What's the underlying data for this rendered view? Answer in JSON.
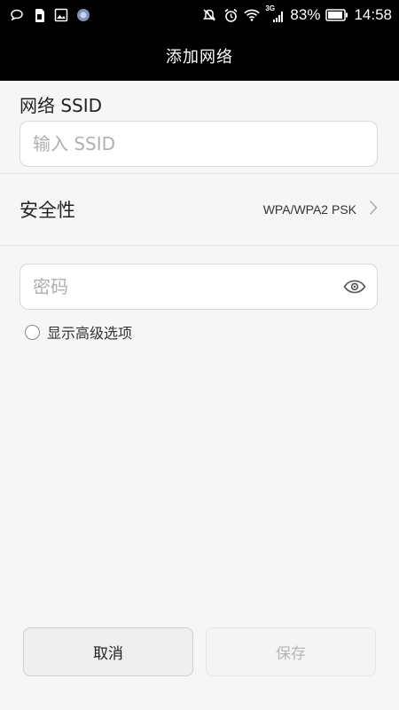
{
  "status_bar": {
    "battery": "83%",
    "time": "14:58",
    "network": "3G",
    "left_icons": [
      "chat-bubble-icon",
      "sim-card-icon",
      "image-icon",
      "app-circle-icon"
    ],
    "right_icons": [
      "vibrate-off-icon",
      "alarm-icon",
      "wifi-icon",
      "signal-icon",
      "battery-icon"
    ]
  },
  "header": {
    "title": "添加网络"
  },
  "ssid": {
    "label": "网络 SSID",
    "placeholder": "输入 SSID",
    "value": ""
  },
  "security": {
    "label": "安全性",
    "value": "WPA/WPA2 PSK"
  },
  "password": {
    "placeholder": "密码",
    "value": ""
  },
  "advanced": {
    "label": "显示高级选项",
    "checked": false
  },
  "buttons": {
    "cancel": "取消",
    "save": "保存"
  },
  "colors": {
    "background": "#f6f6f6",
    "title_bar": "#000000",
    "save_disabled_text": "#b5b5b5"
  }
}
